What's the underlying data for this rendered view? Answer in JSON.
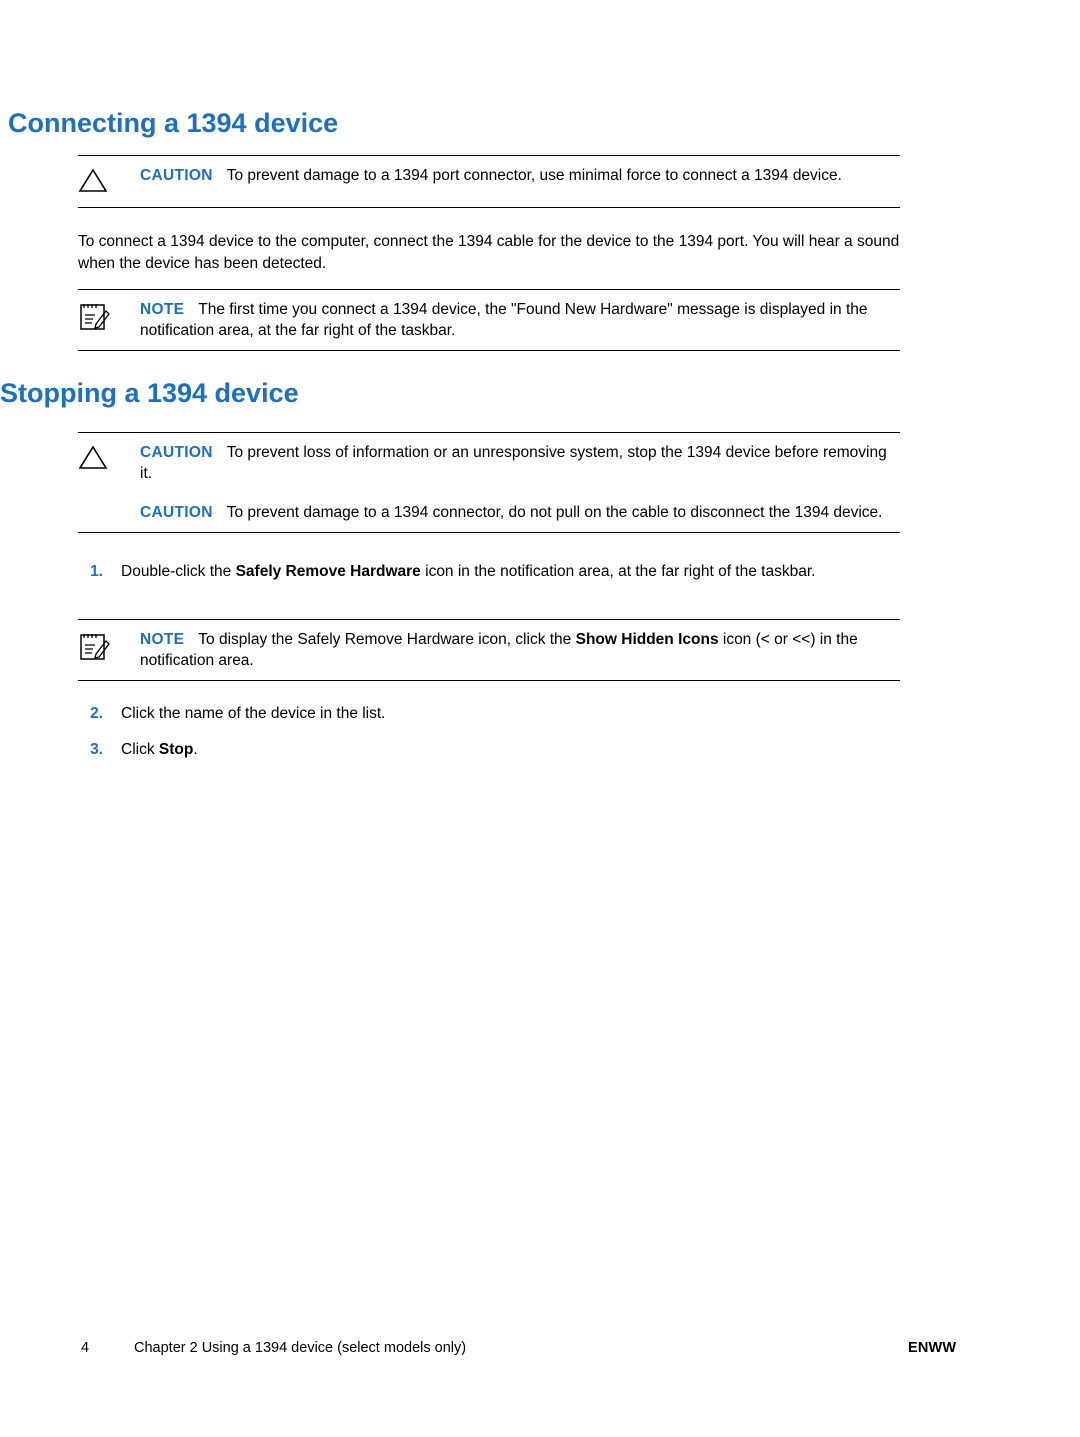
{
  "document": {
    "title1": "Connecting a 1394 device",
    "title2": "Stopping a 1394 device",
    "accent_color": "#1b6fc4"
  },
  "labels": {
    "caution": "CAUTION",
    "note": "NOTE"
  },
  "admonitions": {
    "caution1": "To prevent damage to a 1394 port connector, use minimal force to connect a 1394 device.",
    "note1": "The first time you connect a 1394 device, the \"Found New Hardware\" message is displayed in the notification area, at the far right of the taskbar.",
    "caution2a": "To prevent loss of information or an unresponsive system, stop the 1394 device before removing it.",
    "caution2b": "To prevent damage to a 1394 connector, do not pull on the cable to disconnect the 1394 device.",
    "note2_part1": "To display the Safely Remove Hardware icon, click the ",
    "note2_bold": "Show Hidden Icons",
    "note2_part2": " icon (< or <<) in the notification area."
  },
  "paragraphs": {
    "intro": "To connect a 1394 device to the computer, connect the 1394 cable for the device to the 1394 port. You will hear a sound when the device has been detected."
  },
  "steps": [
    {
      "num": "1.",
      "text_part1": "Double-click the ",
      "bold": "Safely Remove Hardware",
      "text_part2": " icon in the notification area, at the far right of the taskbar."
    },
    {
      "num": "2.",
      "text_part1": "Click the name of the device in the list.",
      "bold": "",
      "text_part2": ""
    },
    {
      "num": "3.",
      "text_part1": "Click ",
      "bold": "Stop",
      "text_part2": "."
    }
  ],
  "footer": {
    "page_number": "4",
    "chapter": "Chapter 2   Using a 1394 device (select models only)",
    "locale": "ENWW"
  }
}
